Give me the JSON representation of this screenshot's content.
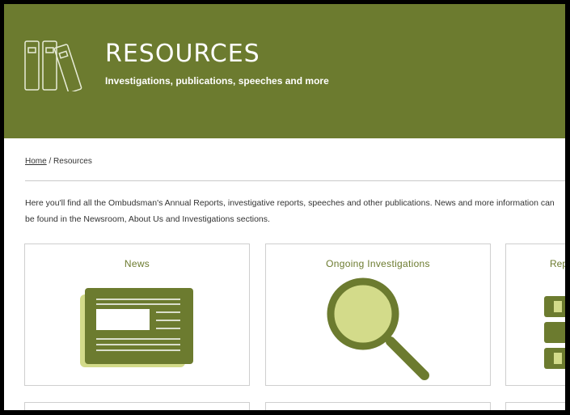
{
  "hero": {
    "title": "RESOURCES",
    "subtitle": "Investigations, publications, speeches and more",
    "icon": "binders-icon",
    "background": "#6c7b2f"
  },
  "breadcrumb": {
    "home": "Home",
    "separator": "/",
    "current": "Resources"
  },
  "intro": {
    "line1": "Here you'll find all the Ombudsman's Annual Reports, investigative reports, speeches and other publications. News and more information can",
    "line2": "be found in the Newsroom, About Us and Investigations sections."
  },
  "cards": [
    {
      "title": "News",
      "icon": "newspaper-icon"
    },
    {
      "title": "Ongoing Investigations",
      "icon": "magnifier-icon"
    },
    {
      "title": "Rep",
      "icon": "reports-icon"
    }
  ],
  "colors": {
    "accent": "#6c7b2f",
    "light": "#d3db8a"
  }
}
